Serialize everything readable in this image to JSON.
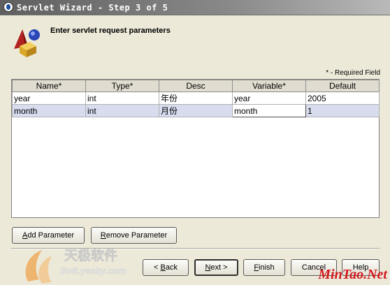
{
  "window": {
    "title": "Servlet Wizard - Step 3 of 5",
    "icon": "app-icon"
  },
  "header": {
    "title": "Enter servlet request parameters",
    "icon": "wizard-shapes-icon"
  },
  "required_note": "* - Required Field",
  "table": {
    "columns": [
      "Name*",
      "Type*",
      "Desc",
      "Variable*",
      "Default"
    ],
    "rows": [
      {
        "name": "year",
        "type": "int",
        "desc": "年份",
        "variable": "year",
        "default": "2005"
      },
      {
        "name": "month",
        "type": "int",
        "desc": "月份",
        "variable": "month",
        "default": "1"
      }
    ],
    "selected_row": 1,
    "editing_cell": "variable"
  },
  "buttons": {
    "add_parameter": {
      "mnemonic": "A",
      "rest": "dd Parameter"
    },
    "remove_parameter": {
      "mnemonic": "R",
      "rest": "emove Parameter"
    },
    "back": {
      "prefix": "< ",
      "mnemonic": "B",
      "rest": "ack"
    },
    "next": {
      "mnemonic": "N",
      "rest": "ext >"
    },
    "finish": {
      "mnemonic": "F",
      "rest": "inish"
    },
    "cancel": {
      "label": "Cancel"
    },
    "help": {
      "label": "Help"
    }
  },
  "watermarks": {
    "left_cn": "天极软件",
    "left_url": "Soft.yesky.com",
    "right": "MinTao.Net"
  },
  "colors": {
    "selected_row": "#d7ddef",
    "titlebar_start": "#5f5f5f",
    "watermark_red": "#d4191f",
    "watermark_orange": "#f08a1c"
  }
}
